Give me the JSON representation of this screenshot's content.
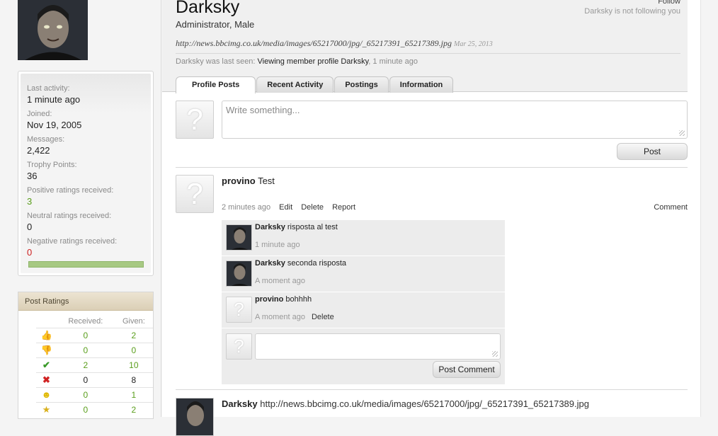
{
  "sidebar": {
    "stats": [
      {
        "label": "Last activity:",
        "value": "1 minute ago",
        "tone": "normal"
      },
      {
        "label": "Joined:",
        "value": "Nov 19, 2005",
        "tone": "normal"
      },
      {
        "label": "Messages:",
        "value": "2,422",
        "tone": "normal"
      },
      {
        "label": "Trophy Points:",
        "value": "36",
        "tone": "normal"
      },
      {
        "label": "Positive ratings received:",
        "value": "3",
        "tone": "green"
      },
      {
        "label": "Neutral ratings received:",
        "value": "0",
        "tone": "normal"
      },
      {
        "label": "Negative ratings received:",
        "value": "0",
        "tone": "red"
      }
    ],
    "rating_bar_positive_fraction": 1.0,
    "post_ratings": {
      "title": "Post Ratings",
      "col_received": "Received:",
      "col_given": "Given:",
      "rows": [
        {
          "icon": "thumbs-up-icon",
          "received": "0",
          "given": "2"
        },
        {
          "icon": "thumbs-down-icon",
          "received": "0",
          "given": "0"
        },
        {
          "icon": "check-icon",
          "received": "2",
          "given": "10"
        },
        {
          "icon": "x-icon",
          "received": "0",
          "given": "8"
        },
        {
          "icon": "smiley-icon",
          "received": "0",
          "given": "1"
        },
        {
          "icon": "star-badge-icon",
          "received": "0",
          "given": "2"
        }
      ]
    }
  },
  "profile": {
    "name": "Darksky",
    "title": "Administrator, Male",
    "follow_label": "Follow",
    "follow_note": "Darksky is not following you",
    "status_url": "http://news.bbcimg.co.uk/media/images/65217000/jpg/_65217391_65217389.jpg",
    "status_date": "Mar 25, 2013",
    "last_seen_prefix": "Darksky was last seen:",
    "last_seen_action": "Viewing member profile",
    "last_seen_target": "Darksky",
    "last_seen_time": ", 1 minute ago"
  },
  "tabs": [
    "Profile Posts",
    "Recent Activity",
    "Postings",
    "Information"
  ],
  "composer": {
    "placeholder": "Write something...",
    "post_label": "Post"
  },
  "post": {
    "author": "provino",
    "text": "Test",
    "time": "2 minutes ago",
    "actions": [
      "Edit",
      "Delete",
      "Report"
    ],
    "comment_label": "Comment",
    "comments": [
      {
        "author": "Darksky",
        "text": "risposta al test",
        "time": "1 minute ago",
        "delete": ""
      },
      {
        "author": "Darksky",
        "text": "seconda risposta",
        "time": "A moment ago",
        "delete": ""
      },
      {
        "author": "provino",
        "text": "bohhhh",
        "time": "A moment ago",
        "delete": "Delete"
      }
    ],
    "post_comment_label": "Post Comment"
  },
  "post2": {
    "author": "Darksky",
    "text": "http://news.bbcimg.co.uk/media/images/65217000/jpg/_65217391_65217389.jpg"
  }
}
